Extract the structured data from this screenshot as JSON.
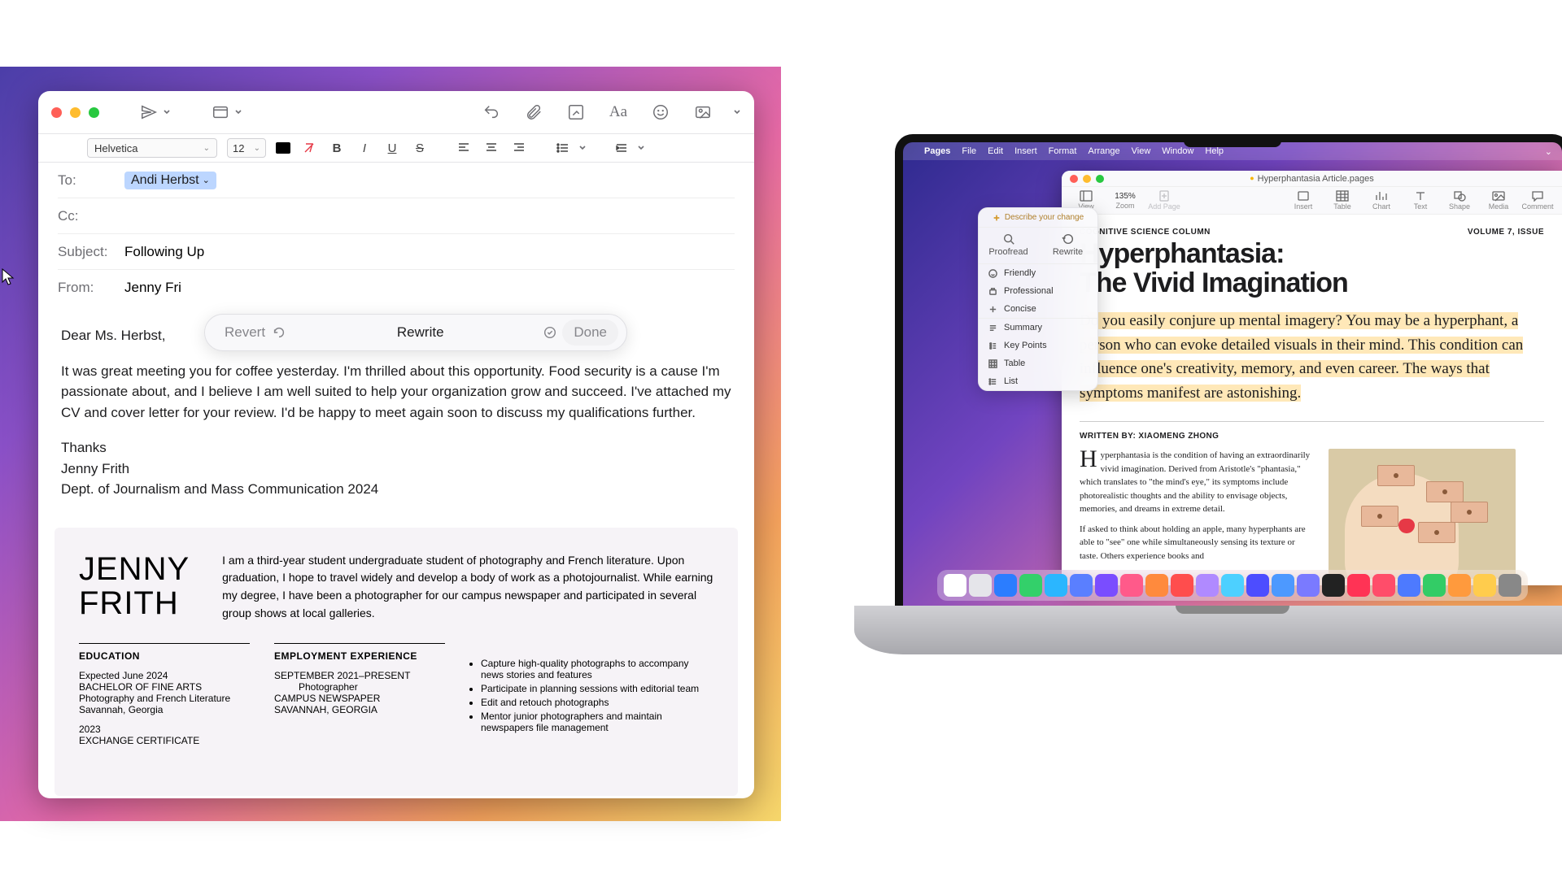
{
  "mail": {
    "font_name": "Helvetica",
    "font_size": "12",
    "to_label": "To:",
    "to_chip": "Andi Herbst",
    "cc_label": "Cc:",
    "subject_label": "Subject:",
    "subject_value": "Following Up",
    "from_label": "From:",
    "from_value": "Jenny Fri",
    "body_greeting": "Dear Ms. Herbst,",
    "body_para": "It was great meeting you for coffee yesterday. I'm thrilled about this opportunity. Food security is a cause I'm passionate about, and I believe I am well suited to help your organization grow and succeed. I've attached my CV and cover letter for your review. I'd be happy to meet again soon to discuss my qualifications further.",
    "body_thanks": "Thanks",
    "body_signame": "Jenny Frith",
    "body_sigdept": "Dept. of Journalism and Mass Communication 2024"
  },
  "rewrite": {
    "revert": "Revert",
    "center": "Rewrite",
    "done": "Done"
  },
  "resume": {
    "name_first": "JENNY",
    "name_last": "FRITH",
    "bio": "I am a third-year student undergraduate student of photography and French literature. Upon graduation, I hope to travel widely and develop a body of work as a photojournalist. While earning my degree, I have been a photographer for our campus newspaper and participated in several group shows at local galleries.",
    "edu_hdr": "EDUCATION",
    "edu_l1": "Expected June 2024",
    "edu_l2": "BACHELOR OF FINE ARTS",
    "edu_l3": "Photography and French Literature",
    "edu_l4": "Savannah, Georgia",
    "edu_l5": "2023",
    "edu_l6": "EXCHANGE CERTIFICATE",
    "emp_hdr": "EMPLOYMENT EXPERIENCE",
    "emp_l1": "SEPTEMBER 2021–PRESENT",
    "emp_l2": "Photographer",
    "emp_l3": "CAMPUS NEWSPAPER",
    "emp_l4": "SAVANNAH, GEORGIA",
    "emp_b1": "Capture high-quality photographs to accompany news stories and features",
    "emp_b2": "Participate in planning sessions with editorial team",
    "emp_b3": "Edit and retouch photographs",
    "emp_b4": "Mentor junior photographers and maintain newspapers file management"
  },
  "mac_menu": {
    "app": "Pages",
    "file": "File",
    "edit": "Edit",
    "insert": "Insert",
    "format": "Format",
    "arrange": "Arrange",
    "view": "View",
    "window": "Window",
    "help": "Help"
  },
  "pages": {
    "doc_title": "Hyperphantasia Article.pages",
    "zoom": "135%",
    "tool_view": "View",
    "tool_zoom": "Zoom",
    "tool_addpage": "Add Page",
    "tool_insert": "Insert",
    "tool_table": "Table",
    "tool_chart": "Chart",
    "tool_text": "Text",
    "tool_shape": "Shape",
    "tool_media": "Media",
    "tool_comment": "Comment"
  },
  "article": {
    "overline_left": "COGNITIVE SCIENCE COLUMN",
    "overline_right": "VOLUME 7, ISSUE",
    "title_l1": "Hyperphantasia:",
    "title_l2": "The Vivid Imagination",
    "intro": "Do you easily conjure up mental imagery? You may be a hyperphant, a person who can evoke detailed visuals in their mind. This condition can influence one's creativity, memory, and even career. The ways that symptoms manifest are astonishing.",
    "byline": "WRITTEN BY: XIAOMENG ZHONG",
    "p1": "yperphantasia is the condition of having an extraordinarily vivid imagination. Derived from Aristotle's \"phantasia,\" which translates to \"the mind's eye,\" its symptoms include photorealistic thoughts and the ability to envisage objects, memories, and dreams in extreme detail.",
    "p2": "If asked to think about holding an apple, many hyperphants are able to \"see\" one while simultaneously sensing its texture or taste. Others experience books and"
  },
  "writing_tools": {
    "describe": "Describe your change",
    "proofread": "Proofread",
    "rewrite": "Rewrite",
    "friendly": "Friendly",
    "professional": "Professional",
    "concise": "Concise",
    "summary": "Summary",
    "keypoints": "Key Points",
    "table": "Table",
    "list": "List"
  },
  "dock_colors": [
    "#ffffff",
    "#e5e5ea",
    "#2b7dff",
    "#33d06a",
    "#2bb6ff",
    "#5a7fff",
    "#7a4dff",
    "#ff5a8a",
    "#ff8a3d",
    "#ff4d4d",
    "#b08aff",
    "#4dd0ff",
    "#4d4dff",
    "#4d99ff",
    "#7a7aff",
    "#222",
    "#ff3355",
    "#ff4d6a",
    "#4d7aff",
    "#33cc66",
    "#ff9a3d",
    "#ffcc4d",
    "#888"
  ]
}
